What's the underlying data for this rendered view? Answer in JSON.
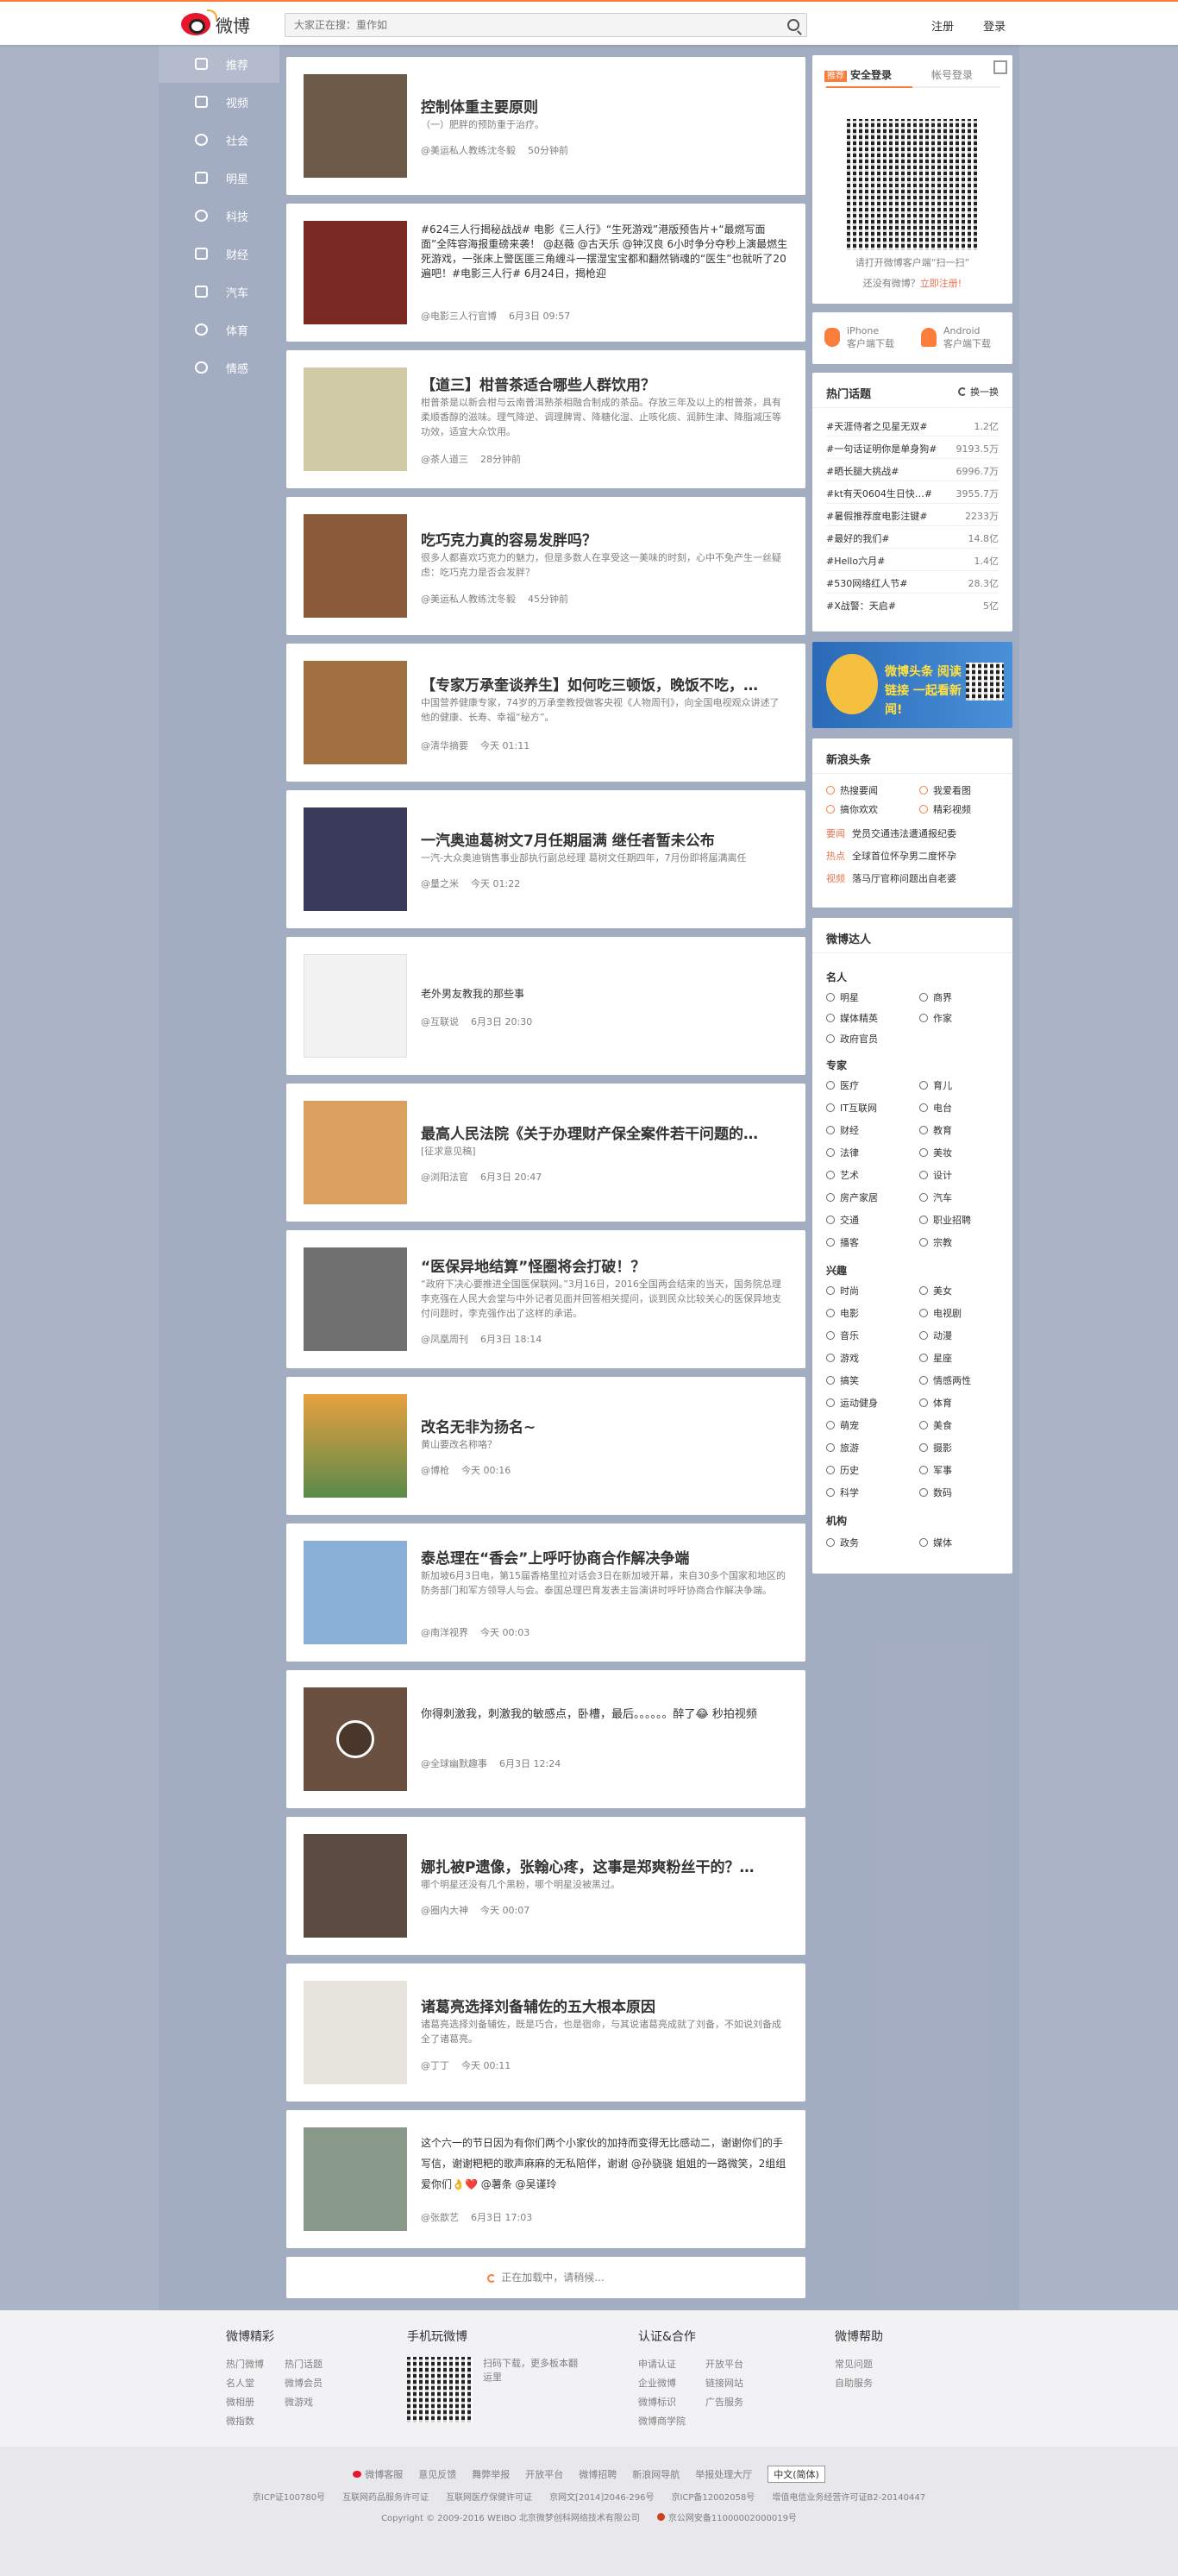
{
  "header": {
    "logo_text": "微博",
    "search_placeholder": "大家正在搜：重作如",
    "login_links": [
      "注册",
      "登录"
    ]
  },
  "sidenav": [
    {
      "label": "推荐",
      "icon": "home-icon"
    },
    {
      "label": "视频",
      "icon": "video-icon"
    },
    {
      "label": "社会",
      "icon": "globe-icon"
    },
    {
      "label": "明星",
      "icon": "star-icon"
    },
    {
      "label": "科技",
      "icon": "atom-icon"
    },
    {
      "label": "财经",
      "icon": "chart-icon"
    },
    {
      "label": "汽车",
      "icon": "car-icon"
    },
    {
      "label": "体育",
      "icon": "ball-icon"
    },
    {
      "label": "情感",
      "icon": "cloud-icon"
    }
  ],
  "feed": [
    {
      "title": "控制体重主要原则",
      "desc": "（一）肥胖的预防重于治疗。",
      "source": "@美运私人教练沈冬毅",
      "time": "50分钟前",
      "thumb": "#6b5a48"
    },
    {
      "title": "",
      "desc": "#624三人行揭秘战战# 电影《三人行》“生死游戏”港版预告片+“最燃写面面”全阵容海报重磅来袭！ @赵薇 @古天乐 @钟汉良 6小时争分夺秒上演最燃生死游戏，一张床上警医匪三角缠斗一摆湿宝宝都和翻然销魂的“医生”也就听了20遍吧！#电影三人行# 6月24日，揭枪迎",
      "source": "@电影三人行官博",
      "time": "6月3日 09:57",
      "thumb": "#7a2a22"
    },
    {
      "title": "【道三】柑普茶适合哪些人群饮用？",
      "desc": "柑普茶是以新会柑与云南普洱熟茶相融合制成的茶品。存放三年及以上的柑普茶，具有柔顺香醇的滋味。理气降逆、调理脾胃、降糖化湿、止咳化痰、润肺生津、降脂减压等功效，适宜大众饮用。",
      "source": "@茶人道三",
      "time": "28分钟前",
      "thumb": "#cfc9a6"
    },
    {
      "title": "吃巧克力真的容易发胖吗？",
      "desc": "很多人都喜欢巧克力的魅力，但是多数人在享受这一美味的时刻，心中不免产生一丝疑虑：吃巧克力是否会发胖？",
      "source": "@美运私人教练沈冬毅",
      "time": "45分钟前",
      "thumb": "#8a5a3a"
    },
    {
      "title": "【专家万承奎谈养生】如何吃三顿饭，晚饭不吃，…",
      "desc": "中国营养健康专家，74岁的万承奎教授做客央视《人物周刊》，向全国电视观众讲述了他的健康、长寿、幸福“秘方”。",
      "source": "@清华摘要",
      "time": "今天 01:11",
      "thumb": "#a07040"
    },
    {
      "title": "一汽奥迪葛树文7月任期届满 继任者暂未公布",
      "desc": "一汽-大众奥迪销售事业部执行副总经理 葛树文任期四年，7月份即将届满离任",
      "source": "@量之米",
      "time": "今天 01:22",
      "thumb": "#3a3a5a"
    },
    {
      "title": "",
      "desc": "老外男友教我的那些事",
      "source": "@互联说",
      "time": "6月3日 20:30",
      "thumb": "#f2f2f2"
    },
    {
      "title": "最高人民法院《关于办理财产保全案件若干问题的…",
      "desc": "[征求意见稿]",
      "source": "@浏阳法官",
      "time": "6月3日 20:47",
      "thumb": "#d9a060"
    },
    {
      "title": "“医保异地结算”怪圈将会打破！？",
      "desc": "“政府下决心要推进全国医保联网。”3月16日，2016全国两会结束的当天，国务院总理李克强在人民大会堂与中外记者见面并回答相关提问，谈到民众比较关心的医保异地支付问题时，李克强作出了这样的承诺。",
      "source": "@凤凰周刊",
      "time": "6月3日 18:14",
      "thumb": "#707070"
    },
    {
      "title": "改名无非为扬名~",
      "desc": "黄山要改名称咯？",
      "source": "@博枪",
      "time": "今天 00:16",
      "thumb": "#5a8a4a"
    },
    {
      "title": "泰总理在“香会”上呼吁协商合作解决争端",
      "desc": "新加坡6月3日电，第15届香格里拉对话会3日在新加坡开幕，来自30多个国家和地区的防务部门和军方领导人与会。泰国总理巴育发表主旨演讲时呼吁协商合作解决争端。",
      "source": "@南洋视界",
      "time": "今天 00:03",
      "thumb": "#8ab0d8"
    },
    {
      "title": "",
      "desc": "你得刺激我，刺激我的敏感点，卧槽，最后。。。。。。醉了😂 秒拍视频",
      "source": "@全球幽默趣事",
      "time": "6月3日 12:24",
      "thumb": "#6a5040"
    },
    {
      "title": "娜扎被P遗像，张翰心疼，这事是郑爽粉丝干的？…",
      "desc": "哪个明星还没有几个黑粉，哪个明星没被黑过。",
      "source": "@圈内大神",
      "time": "今天 00:07",
      "thumb": "#5a4a40"
    },
    {
      "title": "诸葛亮选择刘备辅佐的五大根本原因",
      "desc": "诸葛亮选择刘备辅佐，既是巧合，也是宿命，与其说诸葛亮成就了刘备，不如说刘备成全了诸葛亮。",
      "source": "@丁丁",
      "time": "今天 00:11",
      "thumb": "#e8e4de"
    },
    {
      "title": "",
      "desc": "这个六一的节日因为有你们两个小家伙的加持而变得无比感动二，谢谢你们的手写信，谢谢粑粑的歌声麻麻的无私陪伴，谢谢 @孙骁骁 姐姐的一路微笑，2组组爱你们👌❤️ @薯条 @吴谨玲",
      "source": "@张歆艺",
      "time": "6月3日 17:03",
      "thumb": "#8a9a8a"
    }
  ],
  "loading_text": "正在加载中，请稍候...",
  "login_box": {
    "tab_active_badge": "推荐",
    "tab_active": "安全登录",
    "tab_other": "帐号登录",
    "qr_caption": "请打开微博客户端“扫一扫”",
    "no_account": "还没有微博？",
    "register_link": "立即注册!"
  },
  "apps": [
    {
      "name": "iPhone",
      "sub": "客户端下载"
    },
    {
      "name": "Android",
      "sub": "客户端下载"
    }
  ],
  "hot_topics": {
    "title": "热门话题",
    "refresh": "换一换",
    "items": [
      {
        "topic": "#天涯侍者之见星无双#",
        "count": "1.2亿"
      },
      {
        "topic": "#一句话证明你是单身狗#",
        "count": "9193.5万"
      },
      {
        "topic": "#晒长腿大挑战#",
        "count": "6996.7万"
      },
      {
        "topic": "#kt有天0604生日快…#",
        "count": "3955.7万"
      },
      {
        "topic": "#暑假推荐度电影注键#",
        "count": "2233万"
      },
      {
        "topic": "#最好的我们#",
        "count": "14.8亿"
      },
      {
        "topic": "#Hello六月#",
        "count": "1.4亿"
      },
      {
        "topic": "#530网络红人节#",
        "count": "28.3亿"
      },
      {
        "topic": "#X战警：天启#",
        "count": "5亿"
      }
    ]
  },
  "ad_banner": {
    "text": "微博头条 阅读链接 一起看新闻!"
  },
  "headlines": {
    "title": "新浪头条",
    "links": [
      "热搜要闻",
      "我爱看图",
      "搞你欢欢",
      "精彩视频"
    ],
    "news": [
      {
        "tag": "要闻",
        "text": "党员交通违法遭通报纪委"
      },
      {
        "tag": "热点",
        "text": "全球首位怀孕男二度怀孕"
      },
      {
        "tag": "视频",
        "text": "落马厅官称问题出自老婆"
      }
    ]
  },
  "talent": {
    "title": "微博达人",
    "groups": [
      {
        "name": "名人",
        "items": [
          "明星",
          "商界",
          "媒体精英",
          "作家",
          "政府官员"
        ]
      },
      {
        "name": "专家",
        "items": [
          "医疗",
          "育儿",
          "IT互联网",
          "电台",
          "财经",
          "教育",
          "法律",
          "美妆",
          "艺术",
          "设计",
          "房产家居",
          "汽车",
          "交通",
          "职业招聘",
          "播客",
          "宗教"
        ]
      },
      {
        "name": "兴趣",
        "items": [
          "时尚",
          "美女",
          "电影",
          "电视剧",
          "音乐",
          "动漫",
          "游戏",
          "星座",
          "搞笑",
          "情感两性",
          "运动健身",
          "体育",
          "萌宠",
          "美食",
          "旅游",
          "摄影",
          "历史",
          "军事",
          "科学",
          "数码"
        ]
      },
      {
        "name": "机构",
        "items": [
          "政务",
          "媒体"
        ]
      }
    ]
  },
  "footer": {
    "cols": [
      {
        "title": "微博精彩",
        "links": [
          "热门微博",
          "热门话题",
          "名人堂",
          "微博会员",
          "微相册",
          "微游戏",
          "微指数"
        ]
      },
      {
        "title": "手机玩微博",
        "text": "扫码下载，更多板本翻运里"
      },
      {
        "title": "认证&合作",
        "links": [
          "申请认证",
          "开放平台",
          "企业微博",
          "链接网站",
          "微博标识",
          "广告服务",
          "微博商学院"
        ]
      },
      {
        "title": "微博帮助",
        "links": [
          "常见问题",
          "自助服务"
        ]
      }
    ],
    "bottom_links": [
      "微博客服",
      "意见反馈",
      "舞弊举报",
      "开放平台",
      "微博招聘",
      "新浪网导航",
      "举报处理大厅"
    ],
    "language": "中文(简体)",
    "icp": [
      "京ICP证100780号",
      "互联网药品服务许可证",
      "互联网医疗保健许可证",
      "京网文[2014]2046-296号",
      "京ICP备12002058号",
      "增值电信业务经营许可证B2-20140447"
    ],
    "copyright": "Copyright © 2009-2016 WEIBO 北京微梦创科网络技术有限公司",
    "police": "京公网安备11000002000019号"
  }
}
